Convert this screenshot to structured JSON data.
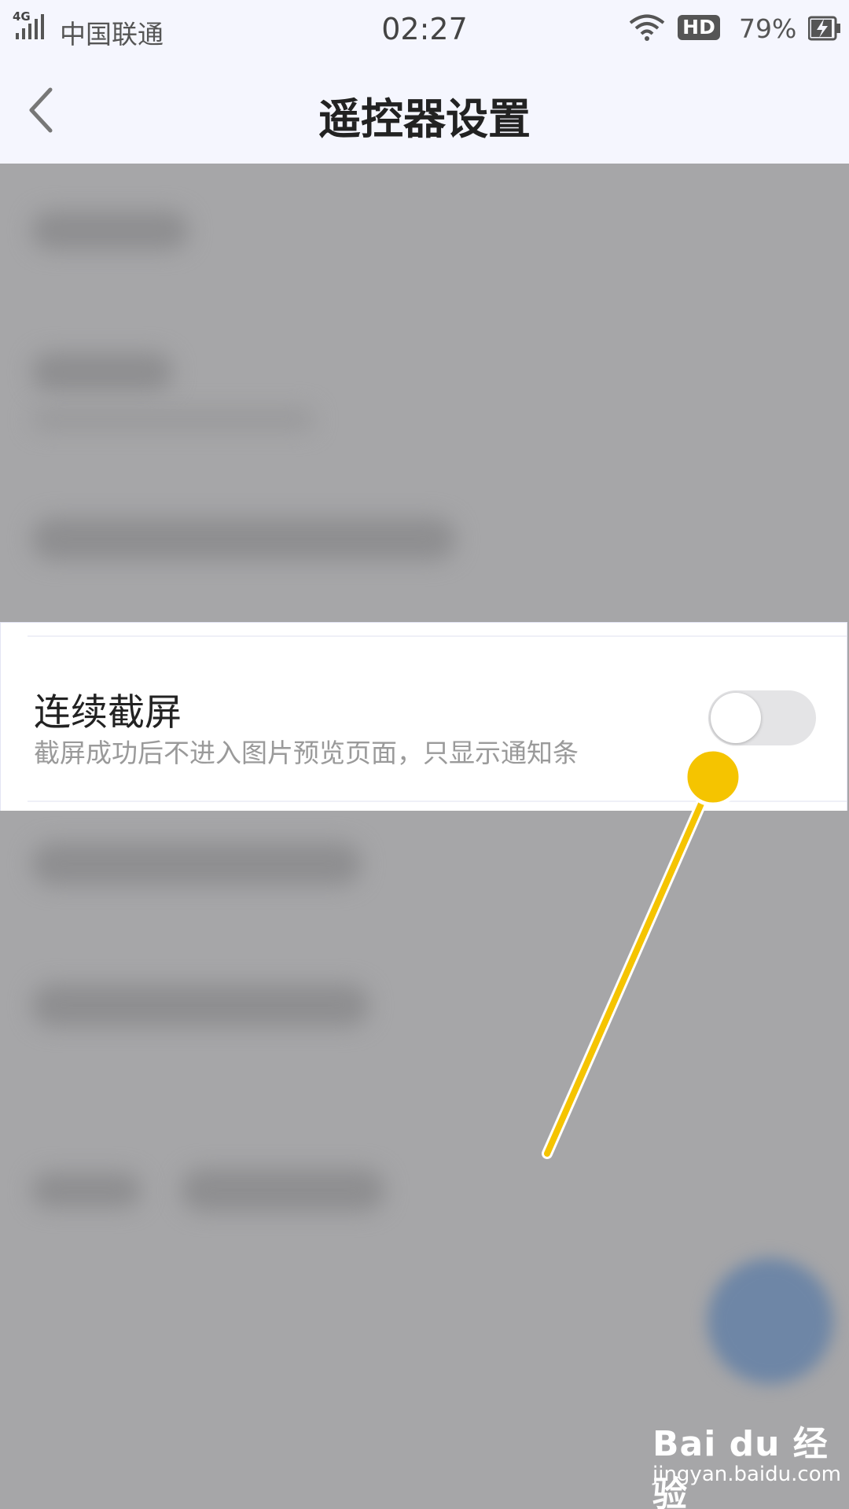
{
  "status_bar": {
    "network": "4G",
    "carrier": "中国联通",
    "time": "02:27",
    "hd_label": "HD",
    "battery_percent": "79%",
    "icons": [
      "signal-icon",
      "wifi-icon",
      "hd-icon",
      "battery-charging-icon"
    ]
  },
  "header": {
    "title": "遥控器设置",
    "back_icon": "chevron-left-icon"
  },
  "setting": {
    "title": "连续截屏",
    "description": "截屏成功后不进入图片预览页面，只显示通知条",
    "toggle_on": false
  },
  "colors": {
    "annotation": "#f5c400",
    "overlay": "#a6a6a8",
    "fab": "#6e86a6"
  },
  "watermark": {
    "logo": "Bai du 经验",
    "url": "jingyan.baidu.com"
  }
}
